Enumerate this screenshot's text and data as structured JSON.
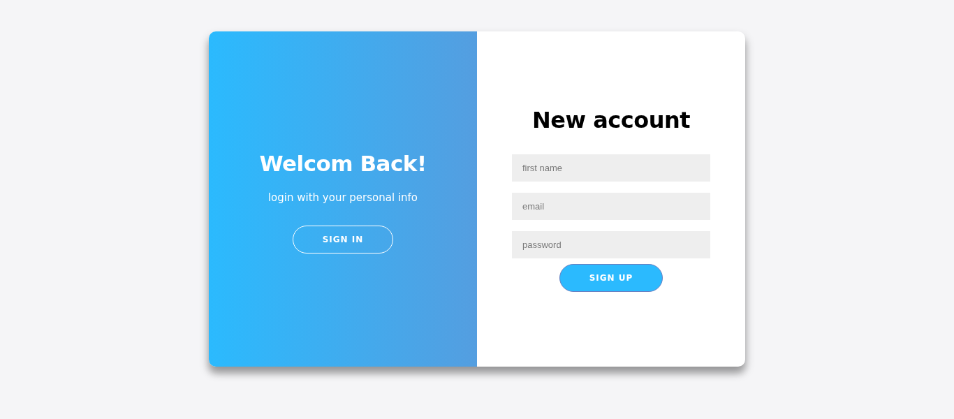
{
  "welcome_panel": {
    "title": "Welcom Back!",
    "subtitle": "login with your personal info",
    "button": "SIGN IN"
  },
  "signup_form": {
    "title": "New account",
    "fields": [
      {
        "placeholder": "first name"
      },
      {
        "placeholder": "email"
      },
      {
        "placeholder": "password"
      }
    ],
    "button": "SIGN UP"
  }
}
